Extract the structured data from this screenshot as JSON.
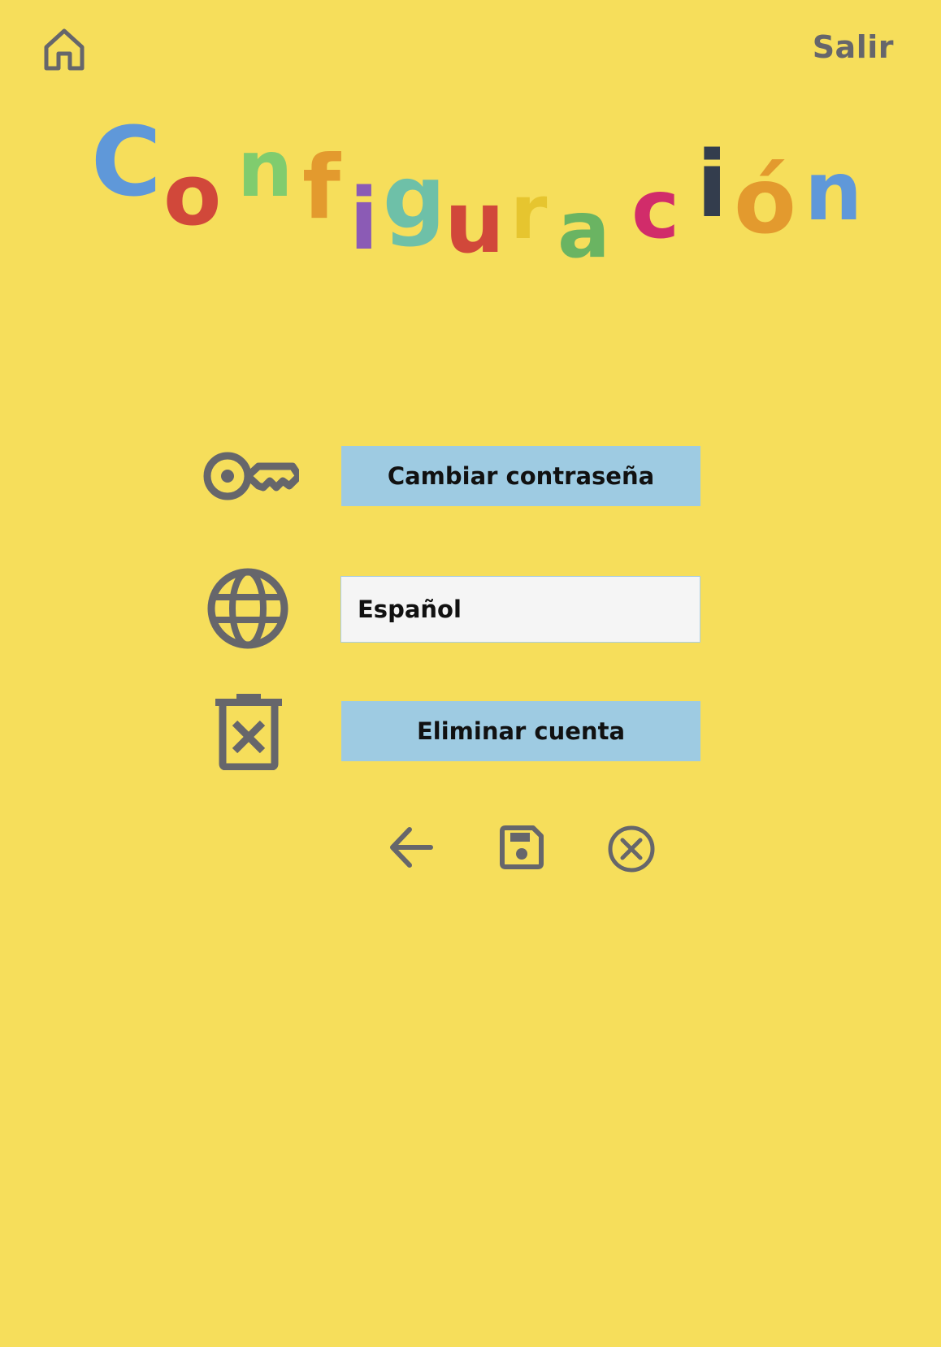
{
  "header": {
    "home_icon": "home-icon",
    "logout_label": "Salir"
  },
  "title": {
    "text": "Configuración",
    "letters": [
      {
        "char": "C",
        "color": "#5f98d9"
      },
      {
        "char": "o",
        "color": "#d1483a"
      },
      {
        "char": "n",
        "color": "#80cc6e"
      },
      {
        "char": "f",
        "color": "#e39a2e"
      },
      {
        "char": "i",
        "color": "#8b5bb5"
      },
      {
        "char": "g",
        "color": "#6ec0a8"
      },
      {
        "char": "u",
        "color": "#d1483a"
      },
      {
        "char": "r",
        "color": "#e6c52f"
      },
      {
        "char": "a",
        "color": "#6ab462"
      },
      {
        "char": "c",
        "color": "#d12c6a"
      },
      {
        "char": "i",
        "color": "#333d4d"
      },
      {
        "char": "ó",
        "color": "#e39a2e"
      },
      {
        "char": "n",
        "color": "#5f98d9"
      }
    ]
  },
  "settings": {
    "change_password": {
      "icon": "key-icon",
      "label": "Cambiar contraseña"
    },
    "language": {
      "icon": "globe-icon",
      "value": "Español"
    },
    "delete_account": {
      "icon": "trash-x-icon",
      "label": "Eliminar cuenta"
    }
  },
  "actions": [
    {
      "icon": "arrow-left-icon"
    },
    {
      "icon": "save-icon"
    },
    {
      "icon": "close-circle-icon"
    }
  ],
  "colors": {
    "background": "#f6de5b",
    "button": "#9ecbe2",
    "icon": "#66666b"
  }
}
